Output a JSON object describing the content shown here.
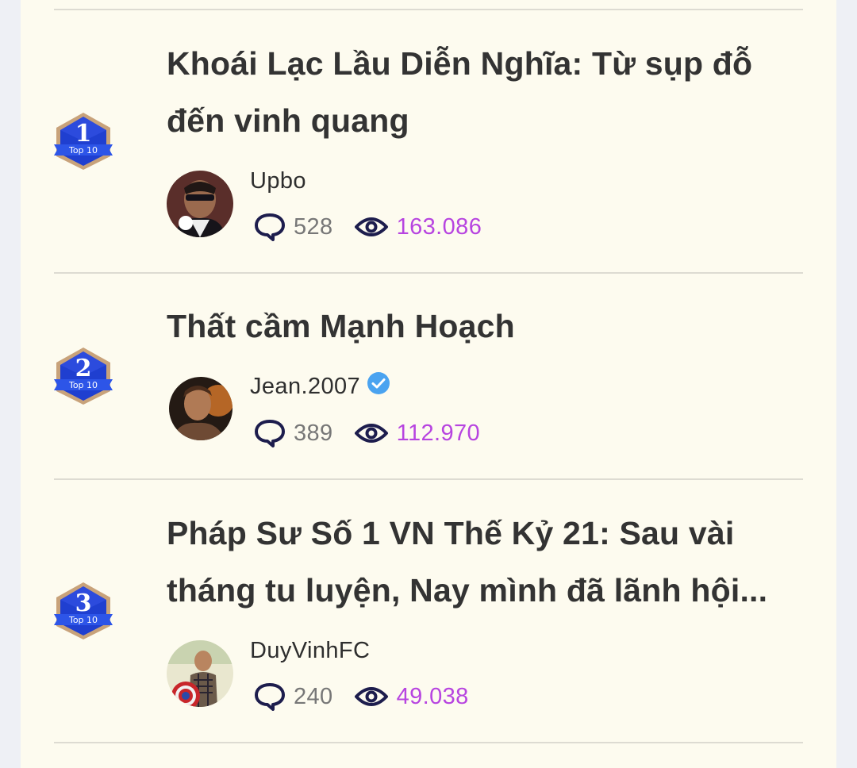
{
  "colors": {
    "background": "#fdfbef",
    "title": "#333333",
    "views": "#b744e0",
    "comments": "#777777",
    "icon": "#1d1d4d",
    "badge_blue": "#1f3fd0",
    "badge_gold": "#c8a27a",
    "verified": "#4aa3f0"
  },
  "icons": {
    "comment": "speech-bubble-icon",
    "views": "eye-icon",
    "verified": "verified-check-icon",
    "rank": "top10-rank-badge"
  },
  "items": [
    {
      "rank": "1",
      "badge_text": "Top 10",
      "title_line1": "Khoái Lạc Lầu Diễn Nghĩa: Từ sụp đỗ",
      "title_line2": "đến vinh quang",
      "author": "Upbo",
      "verified": false,
      "comments": "528",
      "views": "163.086"
    },
    {
      "rank": "2",
      "badge_text": "Top 10",
      "title_line1": "Thất cầm Mạnh Hoạch",
      "author": "Jean.2007",
      "verified": true,
      "comments": "389",
      "views": "112.970"
    },
    {
      "rank": "3",
      "badge_text": "Top 10",
      "title_line1": "Pháp Sư Số 1 VN Thế Kỷ 21: Sau vài",
      "title_line2": "tháng tu luyện, Nay mình đã lãnh hội...",
      "author": "DuyVinhFC",
      "verified": false,
      "comments": "240",
      "views": "49.038"
    }
  ]
}
